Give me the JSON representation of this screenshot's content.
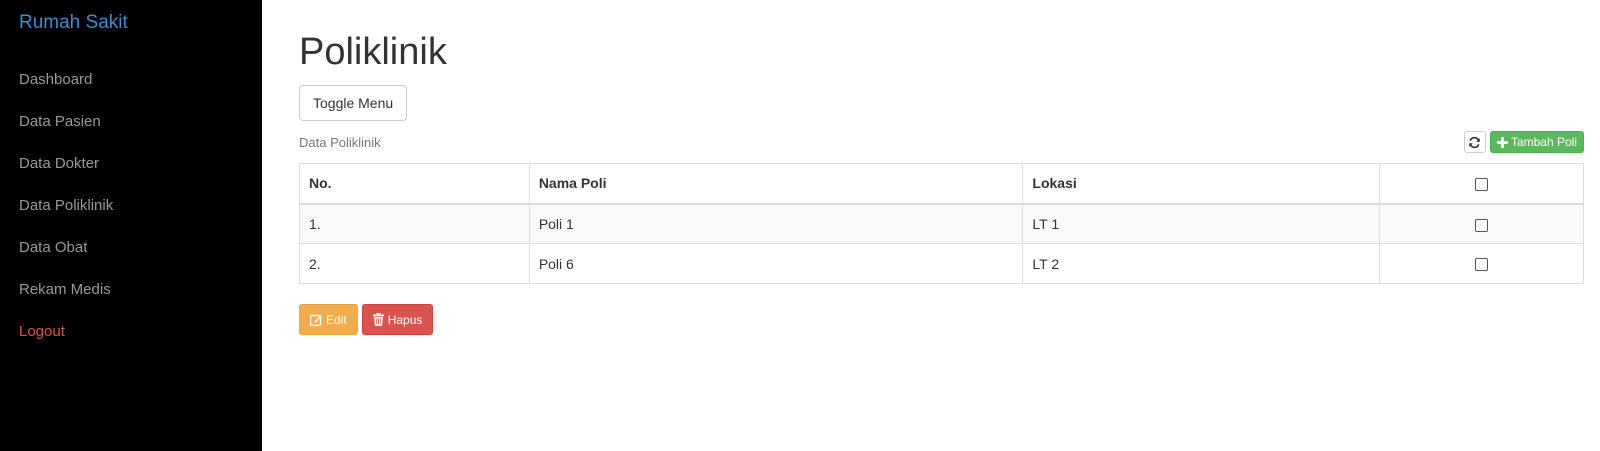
{
  "sidebar": {
    "brand": "Rumah Sakit",
    "items": [
      {
        "label": "Dashboard"
      },
      {
        "label": "Data Pasien"
      },
      {
        "label": "Data Dokter"
      },
      {
        "label": "Data Poliklinik"
      },
      {
        "label": "Data Obat"
      },
      {
        "label": "Rekam Medis"
      }
    ],
    "logout": "Logout"
  },
  "main": {
    "title": "Poliklinik",
    "toggle_label": "Toggle Menu",
    "caption": "Data Poliklinik",
    "refresh_icon": "refresh-icon",
    "add_label": "Tambah Poli",
    "table": {
      "headers": [
        "No.",
        "Nama Poli",
        "Lokasi"
      ],
      "rows": [
        {
          "no": "1.",
          "nama": "Poli 1",
          "lokasi": "LT 1"
        },
        {
          "no": "2.",
          "nama": "Poli 6",
          "lokasi": "LT 2"
        }
      ]
    },
    "edit_label": "Edit",
    "delete_label": "Hapus"
  },
  "colors": {
    "sidebar_bg": "#000000",
    "brand": "#428bca",
    "logout": "#d9534f",
    "add_button": "#5cb85c",
    "edit_button": "#f0ad4e",
    "delete_button": "#d9534f"
  }
}
